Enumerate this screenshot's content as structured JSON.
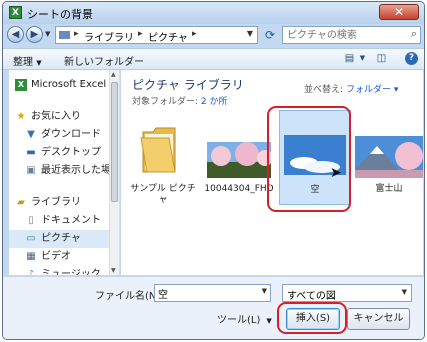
{
  "window": {
    "title": "シートの背景",
    "close_label": "✕"
  },
  "address_bar": {
    "path": [
      "ライブラリ",
      "ピクチャ"
    ]
  },
  "search": {
    "placeholder": "ピクチャの検索"
  },
  "toolbar": {
    "organize_label": "整理",
    "new_folder_label": "新しいフォルダー"
  },
  "nav": {
    "items": [
      {
        "label": "Microsoft Excel",
        "icon": "excel-icon"
      },
      {
        "label": "お気に入り",
        "icon": "star-icon"
      },
      {
        "label": "ダウンロード",
        "icon": "download-folder-icon"
      },
      {
        "label": "デスクトップ",
        "icon": "desktop-icon"
      },
      {
        "label": "最近表示した場所",
        "icon": "recent-places-icon"
      },
      {
        "label": "ライブラリ",
        "icon": "library-icon"
      },
      {
        "label": "ドキュメント",
        "icon": "documents-icon"
      },
      {
        "label": "ピクチャ",
        "icon": "pictures-icon",
        "selected": true
      },
      {
        "label": "ビデオ",
        "icon": "videos-icon"
      },
      {
        "label": "ミュージック",
        "icon": "music-icon"
      }
    ]
  },
  "library": {
    "title": "ピクチャ ライブラリ",
    "subtitle_prefix": "対象フォルダー:",
    "subtitle_link": "2 か所",
    "arrange_label": "並べ替え:",
    "arrange_value": "フォルダー ▾"
  },
  "files": [
    {
      "name": "サンプル ピクチャ",
      "type": "folder"
    },
    {
      "name": "10044304_FHD",
      "type": "image"
    },
    {
      "name": "空",
      "type": "image",
      "selected": true
    },
    {
      "name": "富士山",
      "type": "image"
    }
  ],
  "bottom": {
    "filename_label": "ファイル名(N):",
    "filename_value": "空",
    "filetype_value": "すべての図",
    "tools_label": "ツール(L)",
    "insert_label": "挿入(S)",
    "cancel_label": "キャンセル"
  },
  "colors": {
    "highlight": "#d3202a",
    "title_text": "#1e3a6e",
    "link": "#1a5ad1"
  }
}
